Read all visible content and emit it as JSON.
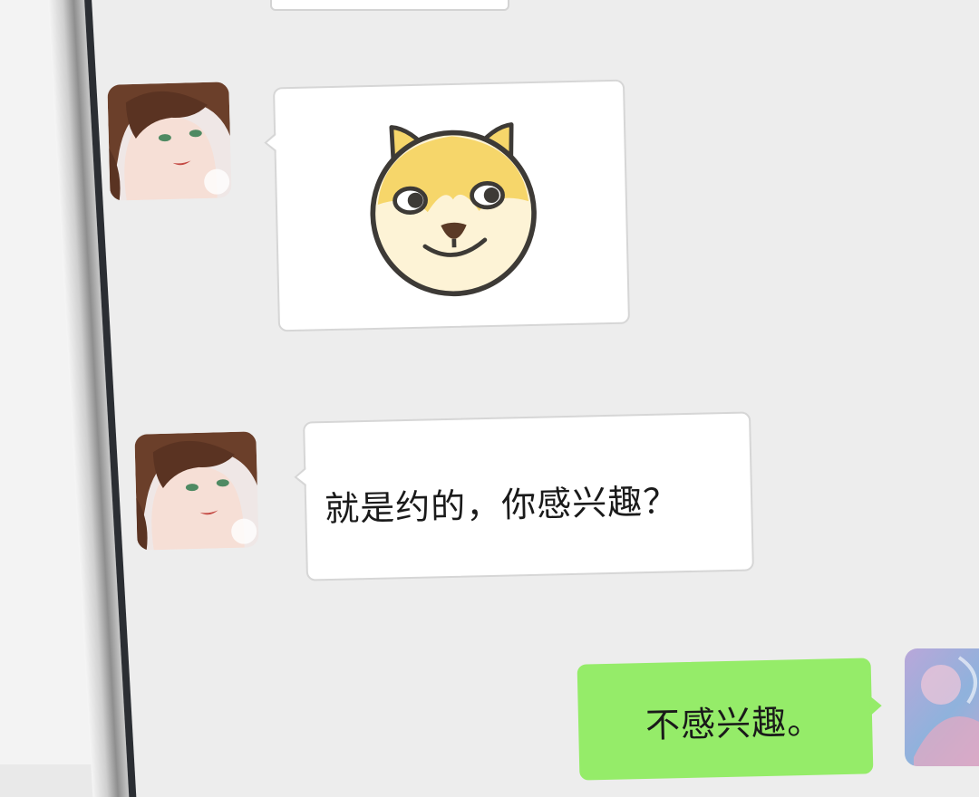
{
  "chat": {
    "messages": [
      {
        "from": "contact",
        "kind": "sticker",
        "sticker_icon": "doge-face-sticker"
      },
      {
        "from": "contact",
        "kind": "text",
        "text": "就是约的，你感兴趣？"
      },
      {
        "from": "me",
        "kind": "text",
        "text": "不感兴趣。"
      }
    ]
  },
  "colors": {
    "chat_background": "#ededed",
    "incoming_bubble": "#ffffff",
    "outgoing_bubble": "#95ec69",
    "sticker_yellow": "#f6d66a",
    "sticker_cream": "#fdf3d6"
  }
}
